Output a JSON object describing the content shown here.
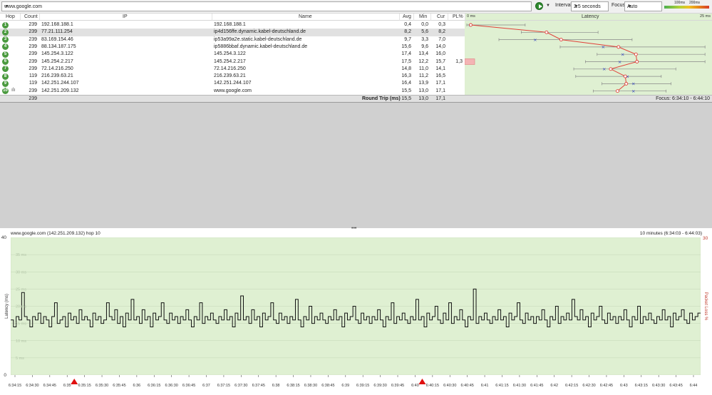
{
  "toolbar": {
    "url": "www.google.com",
    "interval_label": "Interval",
    "interval": "2.5 seconds",
    "focus_label": "Focus",
    "focus": "Auto",
    "legend_100": "100ms",
    "legend_200": "200ms",
    "icons": [
      "dropdown-arrow-icon",
      "play-icon",
      "menu-arrow-icon"
    ]
  },
  "columns": {
    "hop": "Hop",
    "count": "Count",
    "ip": "IP",
    "name": "Name",
    "avg": "Avg",
    "min": "Min",
    "cur": "Cur",
    "pl": "PL%",
    "lat_start": "0 ms",
    "latency": "Latency",
    "lat_end": "25 ms"
  },
  "hops": [
    {
      "hop": "1",
      "count": "239",
      "ip": "192.168.188.1",
      "name": "192.168.188.1",
      "avg": "0,4",
      "min": "0,0",
      "cur": "0,3",
      "pl": "",
      "avg_v": 0.4,
      "min_v": 0.0,
      "cur_v": 0.3,
      "max_v": 6
    },
    {
      "hop": "2",
      "count": "239",
      "ip": "77.21.111.254",
      "name": "ip4d156ffe.dynamic.kabel-deutschland.de",
      "avg": "8,2",
      "min": "5,6",
      "cur": "8,2",
      "pl": "",
      "avg_v": 8.2,
      "min_v": 5.6,
      "cur_v": 8.2,
      "max_v": 13.5
    },
    {
      "hop": "3",
      "count": "239",
      "ip": "83.169.154.46",
      "name": "ip53a99a2e.static.kabel-deutschland.de",
      "avg": "9,7",
      "min": "3,3",
      "cur": "7,0",
      "pl": "",
      "avg_v": 9.7,
      "min_v": 3.3,
      "cur_v": 7.0,
      "max_v": 17
    },
    {
      "hop": "4",
      "count": "239",
      "ip": "88.134.187.175",
      "name": "ip5886bbaf.dynamic.kabel-deutschland.de",
      "avg": "15,6",
      "min": "9,6",
      "cur": "14,0",
      "pl": "",
      "avg_v": 15.6,
      "min_v": 9.6,
      "cur_v": 14.0,
      "max_v": 24.5
    },
    {
      "hop": "5",
      "count": "239",
      "ip": "145.254.3.122",
      "name": "145.254.3.122",
      "avg": "17,4",
      "min": "13,4",
      "cur": "16,0",
      "pl": "",
      "avg_v": 17.4,
      "min_v": 13.4,
      "cur_v": 16.0,
      "max_v": 24.5
    },
    {
      "hop": "6",
      "count": "239",
      "ip": "145.254.2.217",
      "name": "145.254.2.217",
      "avg": "17,5",
      "min": "12,2",
      "cur": "15,7",
      "pl": "1,3",
      "avg_v": 17.5,
      "min_v": 12.2,
      "cur_v": 15.7,
      "max_v": 24.5
    },
    {
      "hop": "7",
      "count": "239",
      "ip": "72.14.216.250",
      "name": "72.14.216.250",
      "avg": "14,8",
      "min": "11,0",
      "cur": "14,1",
      "pl": "",
      "avg_v": 14.8,
      "min_v": 11.0,
      "cur_v": 14.1,
      "max_v": 21.5
    },
    {
      "hop": "8",
      "count": "119",
      "ip": "216.239.63.21",
      "name": "216.239.63.21",
      "avg": "16,3",
      "min": "11,2",
      "cur": "16,5",
      "pl": "",
      "avg_v": 16.3,
      "min_v": 11.2,
      "cur_v": 16.5,
      "max_v": 20
    },
    {
      "hop": "9",
      "count": "119",
      "ip": "142.251.244.107",
      "name": "142.251.244.107",
      "avg": "16,4",
      "min": "13,9",
      "cur": "17,1",
      "pl": "",
      "avg_v": 16.4,
      "min_v": 13.9,
      "cur_v": 17.1,
      "max_v": 21
    },
    {
      "hop": "10",
      "count": "239",
      "ip": "142.251.209.132",
      "name": "www.google.com",
      "avg": "15,5",
      "min": "13,0",
      "cur": "17,1",
      "pl": "",
      "avg_v": 15.5,
      "min_v": 13.0,
      "cur_v": 17.1,
      "max_v": 20.5
    }
  ],
  "totals": {
    "count": "239",
    "label": "Round Trip (ms)",
    "avg": "15,5",
    "min": "13,0",
    "cur": "17,1",
    "focus": "Focus: 6:34:10 - 6:44:10"
  },
  "graph": {
    "title": "www.google.com (142.251.209.132) hop 10",
    "range": "10 minutes (6:34:03 - 6:44:03)",
    "splitter": "•••"
  },
  "chart_data": {
    "type": "line",
    "title": "www.google.com (142.251.209.132) hop 10",
    "ylabel": "Latency (ms)",
    "ylabel_right": "Packet Loss %",
    "ylim": [
      0,
      40
    ],
    "y_right_max": "30",
    "yticks_left": [
      "40",
      "35 ms",
      "30 ms",
      "25 ms",
      "20 ms",
      "15 ms",
      "10 ms",
      "5 ms",
      "0"
    ],
    "xticks": [
      "6:34:15",
      "6:34:30",
      "6:34:45",
      "6:35",
      "6:35:15",
      "6:35:30",
      "6:35:45",
      "6:36",
      "6:36:15",
      "6:36:30",
      "6:36:45",
      "6:37",
      "6:37:15",
      "6:37:30",
      "6:37:45",
      "6:38",
      "6:38:15",
      "6:38:30",
      "6:38:45",
      "6:39",
      "6:39:15",
      "6:39:30",
      "6:39:45",
      "6:40",
      "6:40:15",
      "6:40:30",
      "6:40:45",
      "6:41",
      "6:41:15",
      "6:41:30",
      "6:41:45",
      "6:42",
      "6:42:15",
      "6:42:30",
      "6:42:45",
      "6:43",
      "6:43:15",
      "6:43:30",
      "6:43:45",
      "6:44"
    ],
    "loss_markers": [
      "6:35",
      "6:40"
    ],
    "values": [
      16,
      14,
      17,
      16,
      24,
      17,
      16,
      14,
      17,
      16,
      18,
      15,
      17,
      16,
      14,
      17,
      21,
      15,
      16,
      17,
      14,
      18,
      16,
      17,
      15,
      19,
      16,
      17,
      16,
      14,
      18,
      16,
      17,
      15,
      16,
      21,
      17,
      16,
      19,
      15,
      17,
      14,
      18,
      16,
      22,
      16,
      17,
      15,
      19,
      16,
      17,
      14,
      18,
      16,
      17,
      21,
      16,
      15,
      18,
      16,
      17,
      15,
      17,
      16,
      19,
      16,
      14,
      17,
      16,
      21,
      15,
      17,
      16,
      18,
      16,
      15,
      17,
      16,
      19,
      16,
      17,
      14,
      18,
      16,
      23,
      16,
      17,
      15,
      19,
      16,
      17,
      14,
      18,
      16,
      17,
      21,
      16,
      15,
      18,
      16,
      17,
      15,
      17,
      16,
      22,
      16,
      14,
      17,
      16,
      20,
      15,
      17,
      16,
      18,
      16,
      15,
      17,
      16,
      19,
      16,
      17,
      14,
      18,
      16,
      17,
      20,
      16,
      15,
      18,
      16,
      17,
      15,
      17,
      16,
      19,
      16,
      14,
      17,
      16,
      21,
      15,
      17,
      16,
      18,
      16,
      15,
      17,
      16,
      22,
      16,
      17,
      14,
      18,
      16,
      17,
      20,
      16,
      15,
      18,
      16,
      21,
      15,
      17,
      16,
      19,
      16,
      14,
      17,
      16,
      25,
      15,
      17,
      16,
      18,
      16,
      15,
      17,
      16,
      19,
      16,
      17,
      14,
      18,
      16,
      17,
      21,
      16,
      15,
      18,
      16,
      17,
      15,
      17,
      16,
      19,
      16,
      14,
      17,
      16,
      20,
      15,
      17,
      16,
      18,
      16,
      22,
      17,
      16,
      19,
      16,
      17,
      14,
      18,
      16,
      17,
      20,
      16,
      15,
      18,
      16,
      17,
      15,
      17,
      16,
      19,
      16,
      14,
      17,
      16,
      20,
      15,
      17,
      16,
      18,
      16,
      15,
      17,
      16,
      19,
      16,
      17,
      14,
      18,
      16,
      17,
      19,
      16,
      15,
      18,
      16,
      17,
      18
    ]
  }
}
